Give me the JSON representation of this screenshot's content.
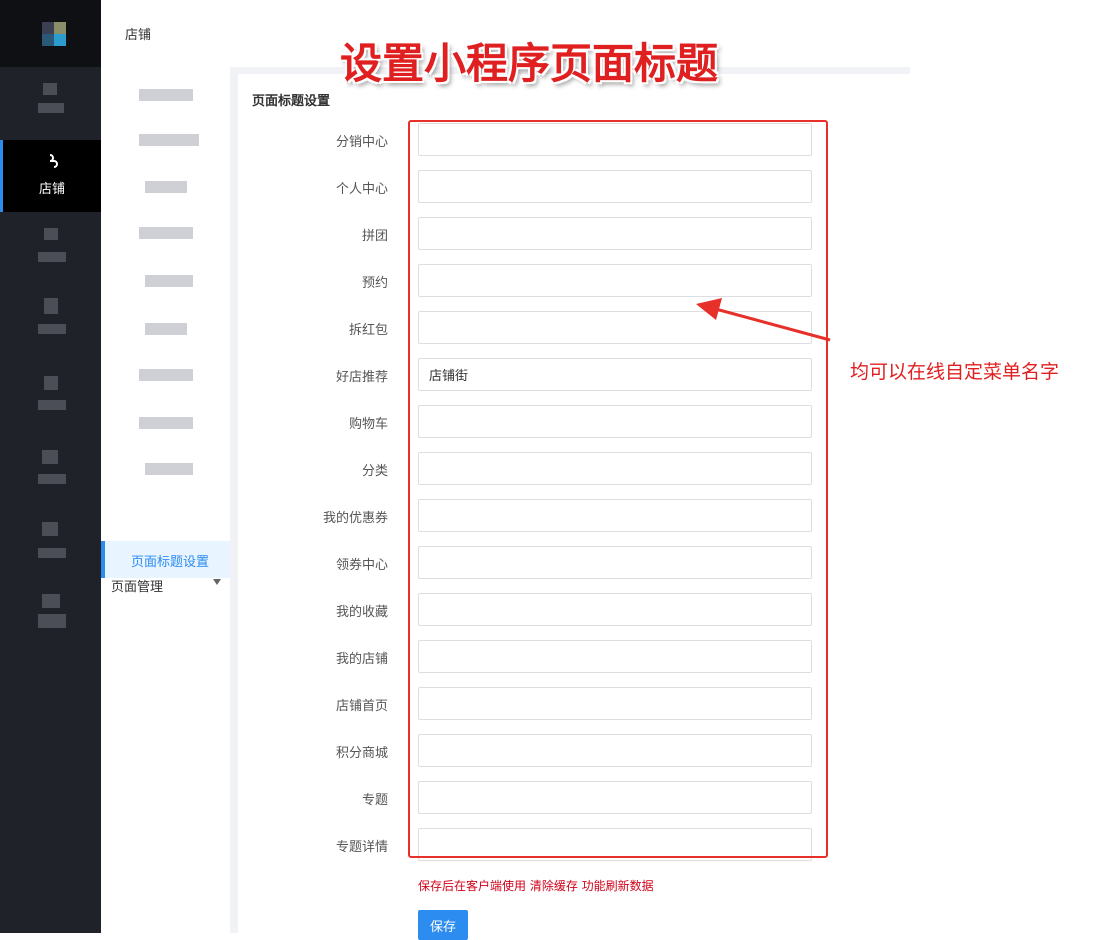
{
  "header": {
    "breadcrumb": "店铺"
  },
  "rail": {
    "active_label": "店铺"
  },
  "submenu": {
    "group_title": "页面管理",
    "active_item": "页面标题设置"
  },
  "form": {
    "section_title": "页面标题设置",
    "fields": [
      {
        "label": "分销中心",
        "value": ""
      },
      {
        "label": "个人中心",
        "value": ""
      },
      {
        "label": "拼团",
        "value": ""
      },
      {
        "label": "预约",
        "value": ""
      },
      {
        "label": "拆红包",
        "value": ""
      },
      {
        "label": "好店推荐",
        "value": "店铺街"
      },
      {
        "label": "购物车",
        "value": ""
      },
      {
        "label": "分类",
        "value": ""
      },
      {
        "label": "我的优惠券",
        "value": ""
      },
      {
        "label": "领券中心",
        "value": ""
      },
      {
        "label": "我的收藏",
        "value": ""
      },
      {
        "label": "我的店铺",
        "value": ""
      },
      {
        "label": "店铺首页",
        "value": ""
      },
      {
        "label": "积分商城",
        "value": ""
      },
      {
        "label": "专题",
        "value": ""
      },
      {
        "label": "专题详情",
        "value": ""
      }
    ],
    "tip": "保存后在客户端使用 清除缓存 功能刷新数据",
    "save_label": "保存"
  },
  "annotations": {
    "title": "设置小程序页面标题",
    "note": "均可以在线自定菜单名字"
  },
  "colors": {
    "accent": "#2d8cf0",
    "rail_bg": "#20222a",
    "annotation_red": "#e02020"
  }
}
